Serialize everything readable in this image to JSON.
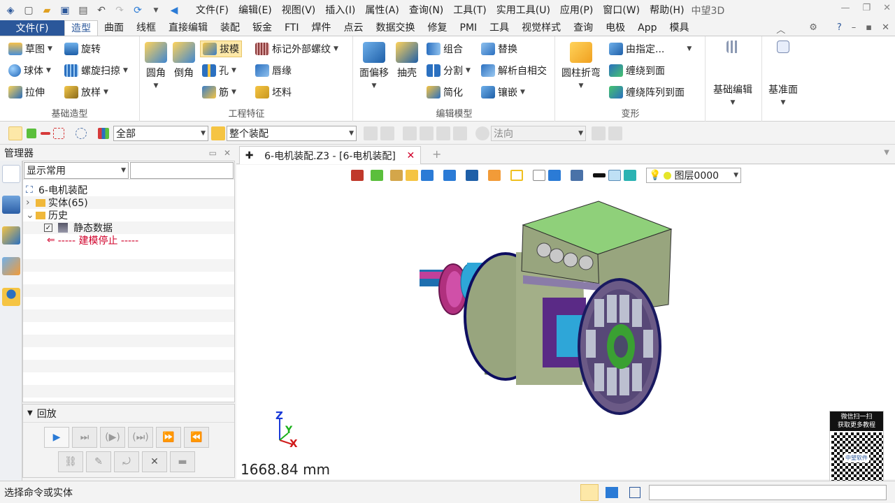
{
  "titlebar": {
    "menus": [
      "文件(F)",
      "编辑(E)",
      "视图(V)",
      "插入(I)",
      "属性(A)",
      "查询(N)",
      "工具(T)",
      "实用工具(U)",
      "应用(P)",
      "窗口(W)",
      "帮助(H)"
    ],
    "app_name": "中望3D"
  },
  "ribbon_tabs": {
    "file": "文件(F)",
    "tabs": [
      "造型",
      "曲面",
      "线框",
      "直接编辑",
      "装配",
      "钣金",
      "FTI",
      "焊件",
      "点云",
      "数据交换",
      "修复",
      "PMI",
      "工具",
      "视觉样式",
      "查询",
      "电极",
      "App",
      "模具"
    ],
    "active": "造型"
  },
  "ribbon": {
    "basic": {
      "label": "基础造型",
      "sketch": "草图",
      "revolve": "旋转",
      "sphere": "球体",
      "sweep_spiral": "螺旋扫掠",
      "extrude": "拉伸",
      "loft": "放样"
    },
    "eng": {
      "label": "工程特征",
      "fillet": "圆角",
      "chamfer": "倒角",
      "draft": "拔模",
      "hole": "孔",
      "rib": "筋",
      "thread": "标记外部螺纹",
      "lip": "唇缘",
      "stock": "坯料"
    },
    "edit": {
      "label": "编辑模型",
      "offset": "面偏移",
      "shell": "抽壳",
      "combine": "组合",
      "split": "分割",
      "simplify": "简化",
      "replace": "替换",
      "self_intersect": "解析自相交",
      "emboss": "镶嵌"
    },
    "deform": {
      "label": "变形",
      "flex": "圆柱折弯",
      "by_spec": "由指定...",
      "wrap": "缠绕到面",
      "wrap_array": "缠绕阵列到面"
    },
    "base_edit": "基础编辑",
    "datum": "基准面"
  },
  "toolbar2": {
    "filter": "全部",
    "scope": "整个装配",
    "direction": "法向"
  },
  "manager": {
    "title": "管理器",
    "display_mode": "显示常用",
    "search_value": ""
  },
  "tree": {
    "root": "6-电机装配",
    "solids": "实体(65)",
    "history": "历史",
    "static": "静态数据",
    "stop": "----- 建模停止 -----"
  },
  "playback": {
    "title": "回放"
  },
  "doc_tab": {
    "title": "6-电机装配.Z3 - [6-电机装配]"
  },
  "viewport": {
    "layer": "图层0000",
    "scale": "1668.84 mm",
    "triad": {
      "x": "X",
      "y": "Y",
      "z": "Z"
    },
    "qr_text1": "微信扫一扫",
    "qr_text2": "获取更多教程",
    "qr_logo": "中望软件"
  },
  "status": {
    "text": "选择命令或实体"
  }
}
